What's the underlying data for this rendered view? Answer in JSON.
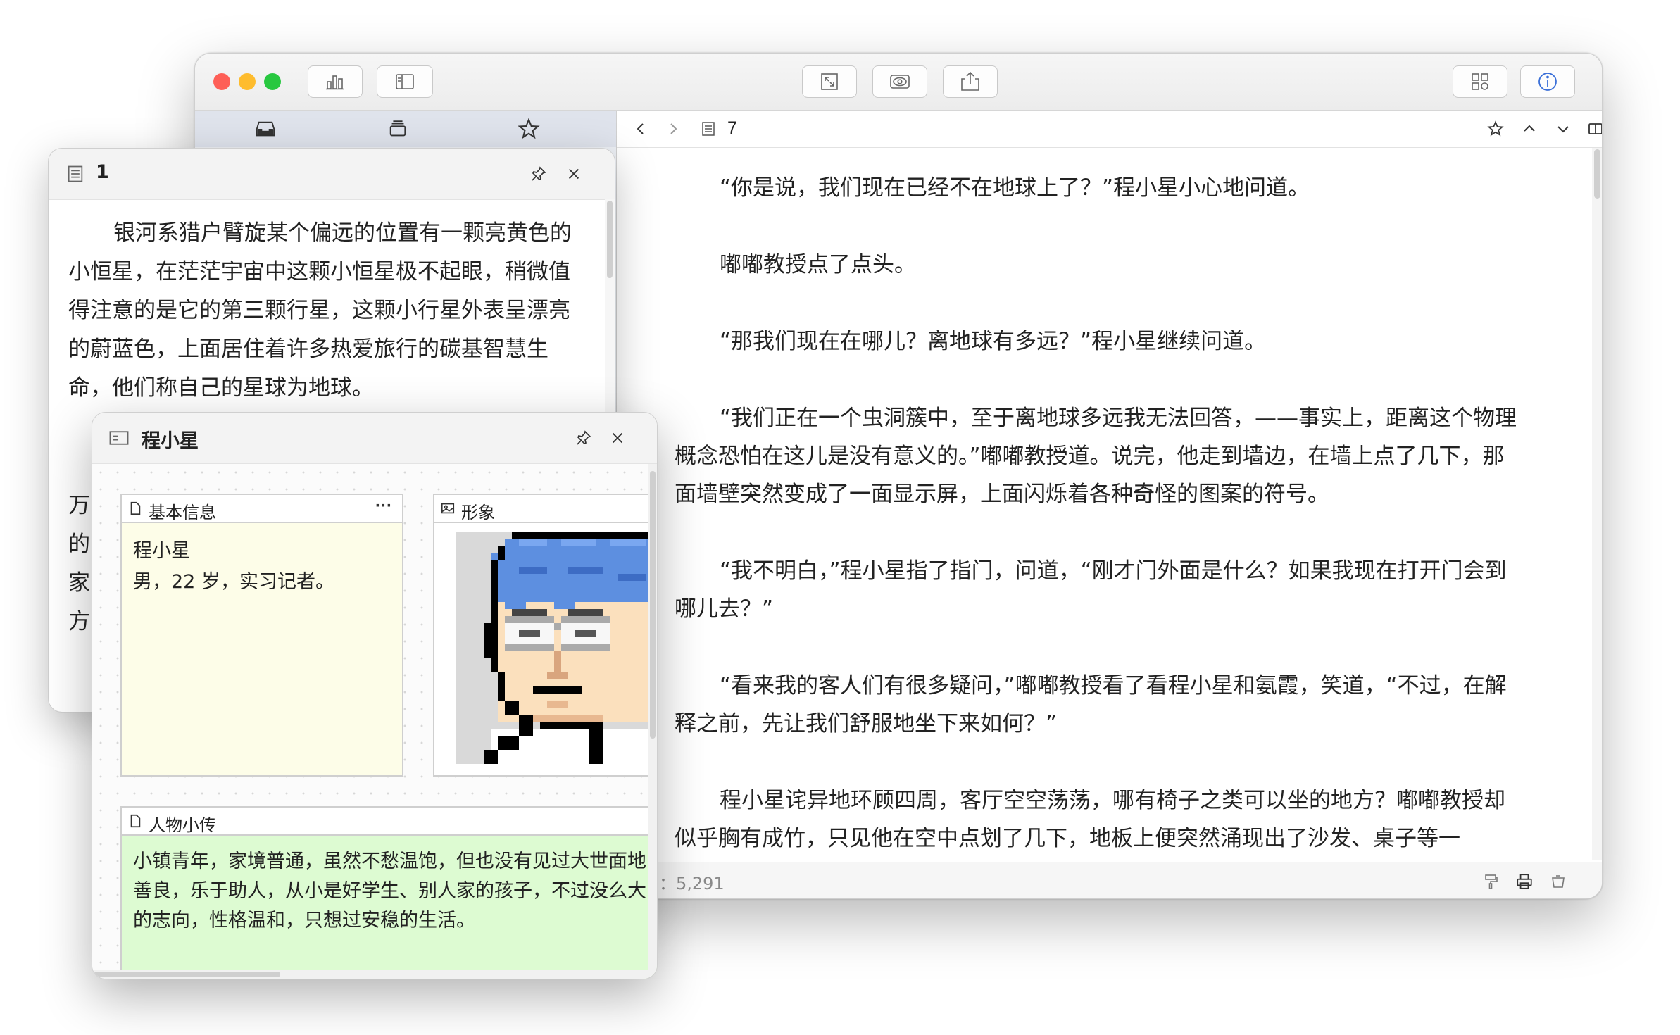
{
  "main_window": {
    "toolbar": {
      "icons": [
        "chart-icon",
        "sidebar-icon",
        "expand-icon",
        "eye-icon",
        "share-icon",
        "grid-icon",
        "info-icon"
      ]
    },
    "sidebar_tabs": [
      "inbox-icon",
      "stack-icon",
      "star-icon"
    ],
    "nav": {
      "page_number": "7"
    },
    "document": {
      "paragraphs": [
        "“你是说，我们现在已经不在地球上了？”程小星小心地问道。",
        "嘟嘟教授点了点头。",
        "“那我们现在在哪儿？离地球有多远？”程小星继续问道。",
        "“我们正在一个虫洞簇中，至于离地球多远我无法回答，——事实上，距离这个物理概念恐怕在这儿是没有意义的。”嘟嘟教授道。说完，他走到墙边，在墙上点了几下，那面墙壁突然变成了一面显示屏，上面闪烁着各种奇怪的图案的符号。",
        "“我不明白，”程小星指了指门，问道，“刚才门外面是什么？如果我现在打开门会到哪儿去？”",
        "“看来我的客人们有很多疑问，”嘟嘟教授看了看程小星和氨霞，笑道，“不过，在解释之前，先让我们舒服地坐下来如何？”",
        "程小星诧异地环顾四周，客厅空空荡荡，哪有椅子之类可以坐的地方？嘟嘟教授却似乎胸有成竹，只见他在空中点划了几下，地板上便突然涌现出了沙发、桌子等一"
      ]
    },
    "status": {
      "word_count": "符：5,291"
    }
  },
  "note_panel": {
    "title": "1",
    "paragraph": "银河系猎户臂旋某个偏远的位置有一颗亮黄色的小恒星，在茫茫宇宙中这颗小恒星极不起眼，稍微值得注意的是它的第三颗行星，这颗小行星外表呈漂亮的蔚蓝色，上面居住着许多热爱旅行的碳基智慧生命，他们称自己的星球为地球。",
    "fragments": [
      "万",
      "的",
      "家",
      "方"
    ]
  },
  "card_panel": {
    "title": "程小星",
    "basic_info": {
      "header": "基本信息",
      "more": "···",
      "name": "程小星",
      "details": "男，22 岁，实习记者。",
      "bg_color": "#fdfde8"
    },
    "image_box": {
      "header": "形象"
    },
    "bio": {
      "header": "人物小传",
      "text": "小镇青年，家境普通，虽然不愁温饱，但也没有见过大世面地善良，乐于助人，从小是好学生、别人家的孩子，不过没么大的志向，性格温和，只想过安稳的生活。",
      "bg_color": "#ddfbd2"
    }
  },
  "colors": {
    "traffic_red": "#fe5f57",
    "traffic_yellow": "#febc2e",
    "traffic_green": "#28c840"
  }
}
